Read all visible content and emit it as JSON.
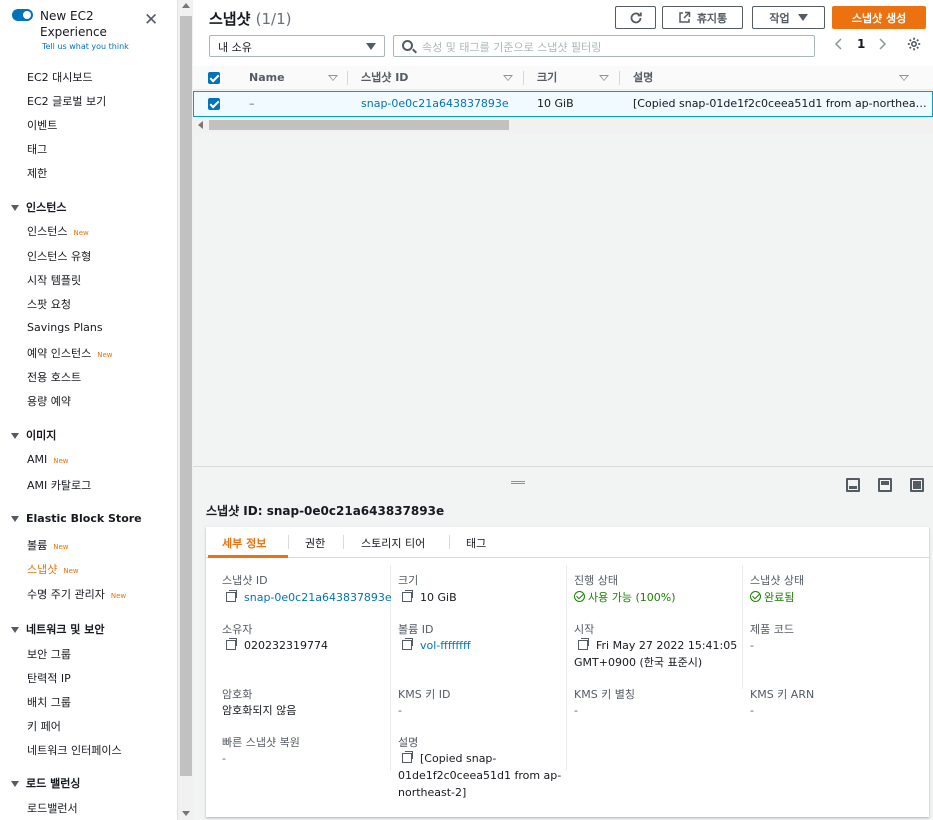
{
  "sidebar": {
    "new_experience": "New EC2 Experience",
    "tell_us": "Tell us what you think",
    "top_items": [
      {
        "label": "EC2 대시보드"
      },
      {
        "label": "EC2 글로벌 보기"
      },
      {
        "label": "이벤트"
      },
      {
        "label": "태그"
      },
      {
        "label": "제한"
      }
    ],
    "sections": [
      {
        "title": "인스턴스",
        "items": [
          {
            "label": "인스턴스",
            "badge": "New"
          },
          {
            "label": "인스턴스 유형"
          },
          {
            "label": "시작 템플릿"
          },
          {
            "label": "스팟 요청"
          },
          {
            "label": "Savings Plans"
          },
          {
            "label": "예약 인스턴스",
            "badge": "New"
          },
          {
            "label": "전용 호스트"
          },
          {
            "label": "용량 예약"
          }
        ]
      },
      {
        "title": "이미지",
        "items": [
          {
            "label": "AMI",
            "badge": "New"
          },
          {
            "label": "AMI 카탈로그"
          }
        ]
      },
      {
        "title": "Elastic Block Store",
        "items": [
          {
            "label": "볼륨",
            "badge": "New"
          },
          {
            "label": "스냅샷",
            "badge": "New"
          },
          {
            "label": "수명 주기 관리자",
            "badge": "New"
          }
        ]
      },
      {
        "title": "네트워크 및 보안",
        "items": [
          {
            "label": "보안 그룹"
          },
          {
            "label": "탄력적 IP"
          },
          {
            "label": "배치 그룹"
          },
          {
            "label": "키 페어"
          },
          {
            "label": "네트워크 인터페이스"
          }
        ]
      },
      {
        "title": "로드 밸런싱",
        "items": [
          {
            "label": "로드밸런서"
          }
        ]
      }
    ]
  },
  "header": {
    "title": "스냅샷",
    "count": "(1/1)",
    "refresh_icon": "refresh-icon",
    "recycle_bin": "휴지통",
    "actions": "작업",
    "create": "스냅샷 생성"
  },
  "filter": {
    "owner_select": "내 소유",
    "search_placeholder": "속성 및 태그를 기준으로 스냅샷 필터링",
    "page": "1"
  },
  "table": {
    "columns": [
      "Name",
      "스냅샷 ID",
      "크기",
      "설명"
    ],
    "rows": [
      {
        "name": "–",
        "snapshot_id": "snap-0e0c21a643837893e",
        "size": "10 GiB",
        "description": "[Copied snap-01de1f2c0ceea51d1 from ap-northea…"
      }
    ]
  },
  "detail": {
    "title": "스냅샷 ID: snap-0e0c21a643837893e",
    "tabs": [
      "세부 정보",
      "권한",
      "스토리지 티어",
      "태그"
    ],
    "fields": {
      "snapshot_id_label": "스냅샷 ID",
      "snapshot_id": "snap-0e0c21a643837893e",
      "size_label": "크기",
      "size": "10 GiB",
      "progress_label": "진행 상태",
      "progress": "사용 가능 (100%)",
      "state_label": "스냅샷 상태",
      "state": "완료됨",
      "owner_label": "소유자",
      "owner": "020232319774",
      "volume_label": "볼륨 ID",
      "volume": "vol-ffffffff",
      "started_label": "시작",
      "started": "Fri May 27 2022 15:41:05 GMT+0900 (한국 표준시)",
      "product_code_label": "제품 코드",
      "product_code": "-",
      "encryption_label": "암호화",
      "encryption": "암호화되지 않음",
      "kms_id_label": "KMS 키 ID",
      "kms_id": "-",
      "kms_alias_label": "KMS 키 별칭",
      "kms_alias": "-",
      "kms_arn_label": "KMS 키 ARN",
      "kms_arn": "-",
      "fast_restore_label": "빠른 스냅샷 복원",
      "fast_restore": "-",
      "description_label": "설명",
      "description": "[Copied snap-01de1f2c0ceea51d1 from ap-northeast-2]"
    }
  },
  "colors": {
    "accent": "#ec7211",
    "link": "#0073bb",
    "success": "#1d8102"
  }
}
